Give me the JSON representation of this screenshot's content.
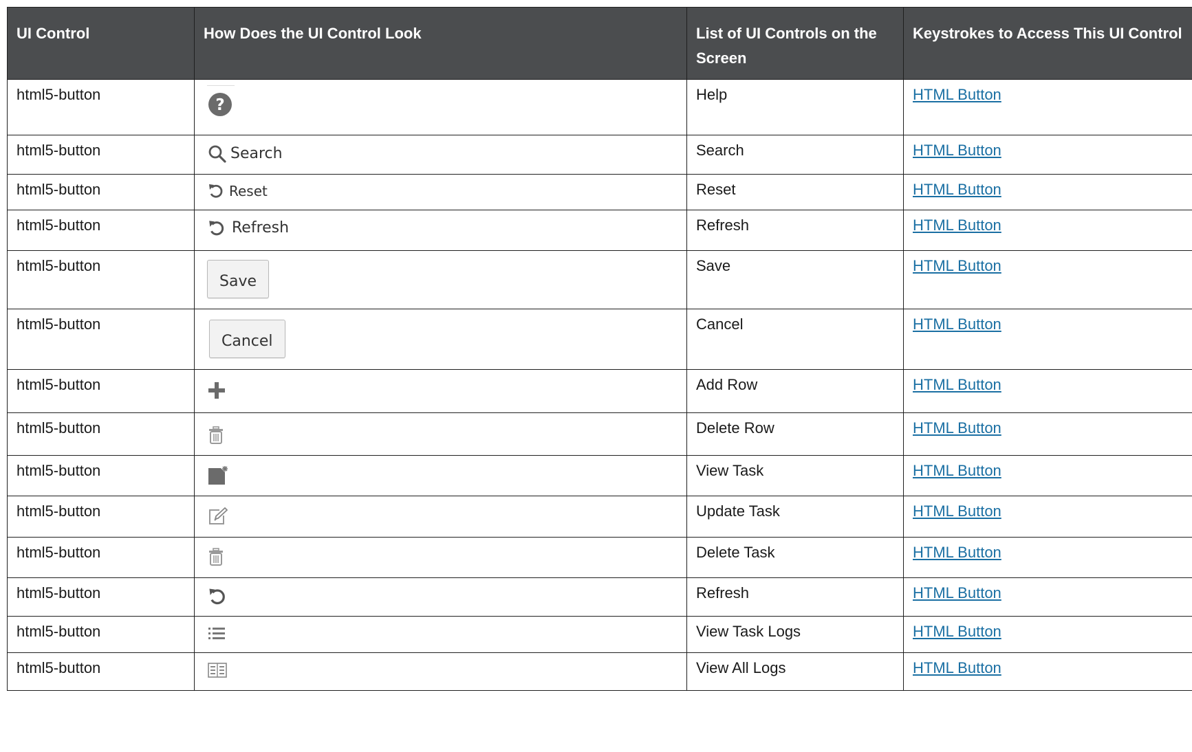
{
  "headers": [
    "UI Control",
    "How Does the UI Control Look",
    "List of UI Controls on the Screen",
    "Keystrokes to Access This UI Control"
  ],
  "rows": [
    {
      "control": "html5-button",
      "icon": "help-icon",
      "name": "Help",
      "link": "HTML Button"
    },
    {
      "control": "html5-button",
      "icon": "search-icon",
      "icon_label": "Search",
      "name": "Search",
      "link": "HTML Button"
    },
    {
      "control": "html5-button",
      "icon": "reset-icon",
      "icon_label": "Reset",
      "name": "Reset",
      "link": "HTML Button"
    },
    {
      "control": "html5-button",
      "icon": "refresh-icon",
      "icon_label": "Refresh",
      "name": "Refresh",
      "link": "HTML Button"
    },
    {
      "control": "html5-button",
      "icon": "save-button",
      "icon_label": "Save",
      "name": "Save",
      "link": "HTML Button"
    },
    {
      "control": "html5-button",
      "icon": "cancel-button",
      "icon_label": "Cancel",
      "name": "Cancel",
      "link": "HTML Button"
    },
    {
      "control": "html5-button",
      "icon": "plus-icon",
      "name": "Add Row",
      "link": "HTML Button"
    },
    {
      "control": "html5-button",
      "icon": "trash-icon",
      "name": "Delete Row",
      "link": "HTML Button"
    },
    {
      "control": "html5-button",
      "icon": "view-task-icon",
      "name": "View Task",
      "link": "HTML Button"
    },
    {
      "control": "html5-button",
      "icon": "edit-icon",
      "name": "Update Task",
      "link": "HTML Button"
    },
    {
      "control": "html5-button",
      "icon": "trash-icon",
      "name": "Delete Task",
      "link": "HTML Button"
    },
    {
      "control": "html5-button",
      "icon": "refresh-icon",
      "name": "Refresh",
      "link": "HTML Button"
    },
    {
      "control": "html5-button",
      "icon": "list-icon",
      "name": "View Task Logs",
      "link": "HTML Button"
    },
    {
      "control": "html5-button",
      "icon": "logs-grid-icon",
      "name": "View All Logs",
      "link": "HTML Button"
    }
  ]
}
